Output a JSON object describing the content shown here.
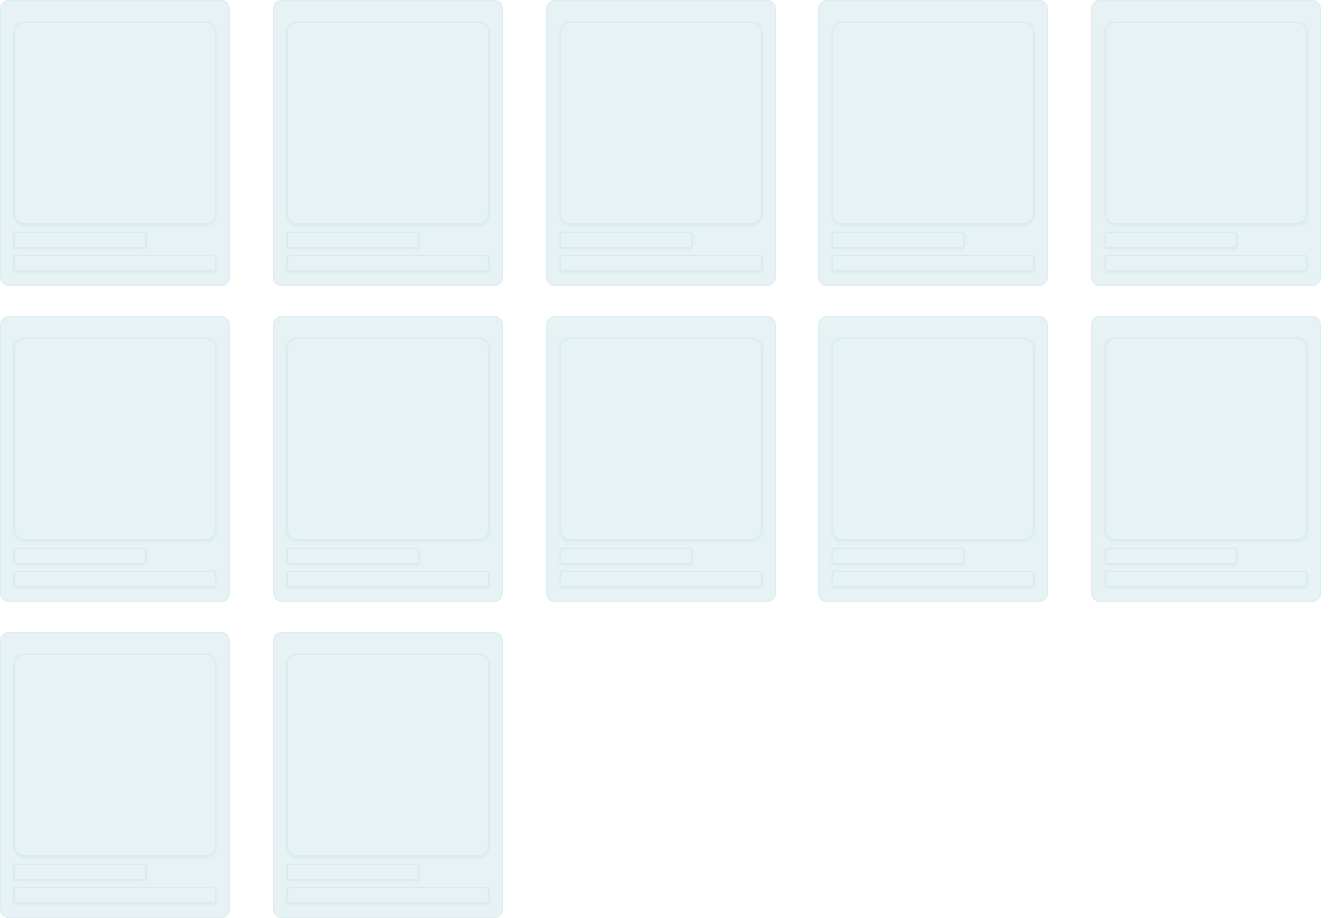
{
  "skeleton_grid": {
    "card_count": 12,
    "columns": 5,
    "loading": true,
    "colors": {
      "card_background": "#e6f2f3",
      "placeholder_border": "#d8eaf0"
    }
  }
}
